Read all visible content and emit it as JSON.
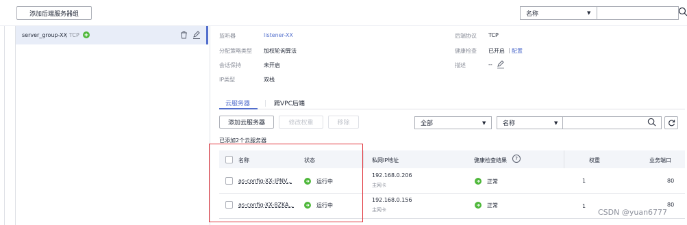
{
  "toolbar": {
    "add_group_label": "添加后端服务器组",
    "search_field_select": "名称",
    "search_value": ""
  },
  "sidebar": {
    "group": {
      "name": "server_group-XX",
      "separator": "|",
      "protocol": "TCP"
    }
  },
  "details": {
    "listener_label": "监听器",
    "listener_value": "listener-XX",
    "algo_label": "分配策略类型",
    "algo_value": "加权轮询算法",
    "session_label": "会话保持",
    "session_value": "未开启",
    "ip_label": "IP类型",
    "ip_value": "双栈",
    "backend_protocol_label": "后端协议",
    "backend_protocol_value": "TCP",
    "health_label": "健康检查",
    "health_value": "已开启",
    "health_sep": "|",
    "health_config": "配置",
    "desc_label": "描述",
    "desc_value": "--"
  },
  "tabs": [
    {
      "label": "云服务器",
      "active": true
    },
    {
      "label": "跨VPC后端",
      "active": false
    }
  ],
  "actions": {
    "add_server": "添加云服务器",
    "modify_weight": "修改权重",
    "remove": "移除",
    "status_filter": "全部",
    "search_field": "名称",
    "search_value": ""
  },
  "summary": "已添加2个云服务器",
  "table": {
    "headers": {
      "name": "名称",
      "status": "状态",
      "private_ip": "私网IP地址",
      "health": "健康检查结果",
      "weight": "权重",
      "port": "业务端口"
    },
    "rows": [
      {
        "name": "as-config-XX-JPNV...",
        "status": "运行中",
        "ip": "192.168.0.206",
        "nic": "主网卡",
        "health": "正常",
        "weight": "1",
        "port": "80"
      },
      {
        "name": "as-config-XX-8ZKA...",
        "status": "运行中",
        "ip": "192.168.0.156",
        "nic": "主网卡",
        "health": "正常",
        "weight": "1",
        "port": "80"
      }
    ]
  },
  "watermark": "CSDN @yuan6777",
  "colors": {
    "accent": "#526ecc",
    "success": "#50b83c",
    "highlight_box": "#e0323a"
  }
}
